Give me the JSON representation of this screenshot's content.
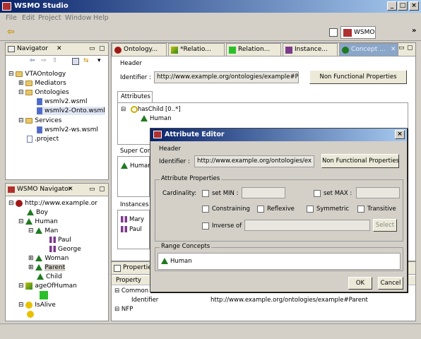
{
  "window": {
    "title": "WSMO Studio",
    "min": "_",
    "max": "□",
    "close": "×"
  },
  "menu": [
    "File",
    "Edit",
    "Project",
    "Window",
    "Help"
  ],
  "perspective": {
    "label": "WSMO"
  },
  "navigator": {
    "title": "Navigator",
    "items": [
      {
        "label": "VTAOntology",
        "icon": "project-icon"
      },
      {
        "label": "Mediators",
        "icon": "folder-icon"
      },
      {
        "label": "Ontologies",
        "icon": "folder-icon"
      },
      {
        "label": "wsmlv2.wsml",
        "icon": "wsml-file-icon"
      },
      {
        "label": "wsmlv2-Onto.wsml",
        "icon": "wsml-file-icon"
      },
      {
        "label": "Services",
        "icon": "folder-icon"
      },
      {
        "label": "wsmlv2-ws.wsml",
        "icon": "wsml-file-icon"
      },
      {
        "label": ".project",
        "icon": "file-icon"
      }
    ]
  },
  "wsmo_nav": {
    "title": "WSMO Navigator",
    "items": [
      "http://www.example.or",
      "Boy",
      "Human",
      "Man",
      "Paul",
      "George",
      "Woman",
      "Parent",
      "Child",
      "ageOfHuman",
      "",
      "IsAlive"
    ]
  },
  "editor": {
    "tabs": [
      "Ontology...",
      "*Relatio...",
      "Relation...",
      "Instance...",
      "Concept ..."
    ],
    "header_label": "Header",
    "identifier_label": "Identifier :",
    "identifier_value": "http://www.example.org/ontologies/example#Parent",
    "nfp_button": "Non Functional Properties",
    "attributes_tab": "Attributes",
    "attribute_item": "hasChild [0..*]",
    "attribute_range": "Human",
    "super_label": "Super Conc",
    "super_item": "Human",
    "instances_label": "Instances",
    "instances": [
      "Mary",
      "Paul"
    ]
  },
  "properties": {
    "title": "Properties",
    "col_property": "Property",
    "group_common": "Common",
    "identifier_label": "Identifier",
    "identifier_value": "http://www.example.org/ontologies/example#Parent",
    "group_nfp": "NFP"
  },
  "dialog": {
    "title": "Attribute Editor",
    "header_label": "Header",
    "identifier_label": "Identifier :",
    "identifier_value": "http://www.example.org/ontologies/ex",
    "nfp_button": "Non Functional Properties",
    "attr_props_label": "Attribute Properties",
    "cardinality_label": "Cardinality:",
    "set_min": "set MIN :",
    "set_max": "set MAX :",
    "constraining": "Constraining",
    "reflexive": "Reflexive",
    "symmetric": "Symmetric",
    "transitive": "Transitive",
    "inverse_of": "Inverse of",
    "select_button": "Select",
    "range_label": "Range Concepts",
    "range_item": "Human",
    "ok": "OK",
    "cancel": "Cancel"
  }
}
